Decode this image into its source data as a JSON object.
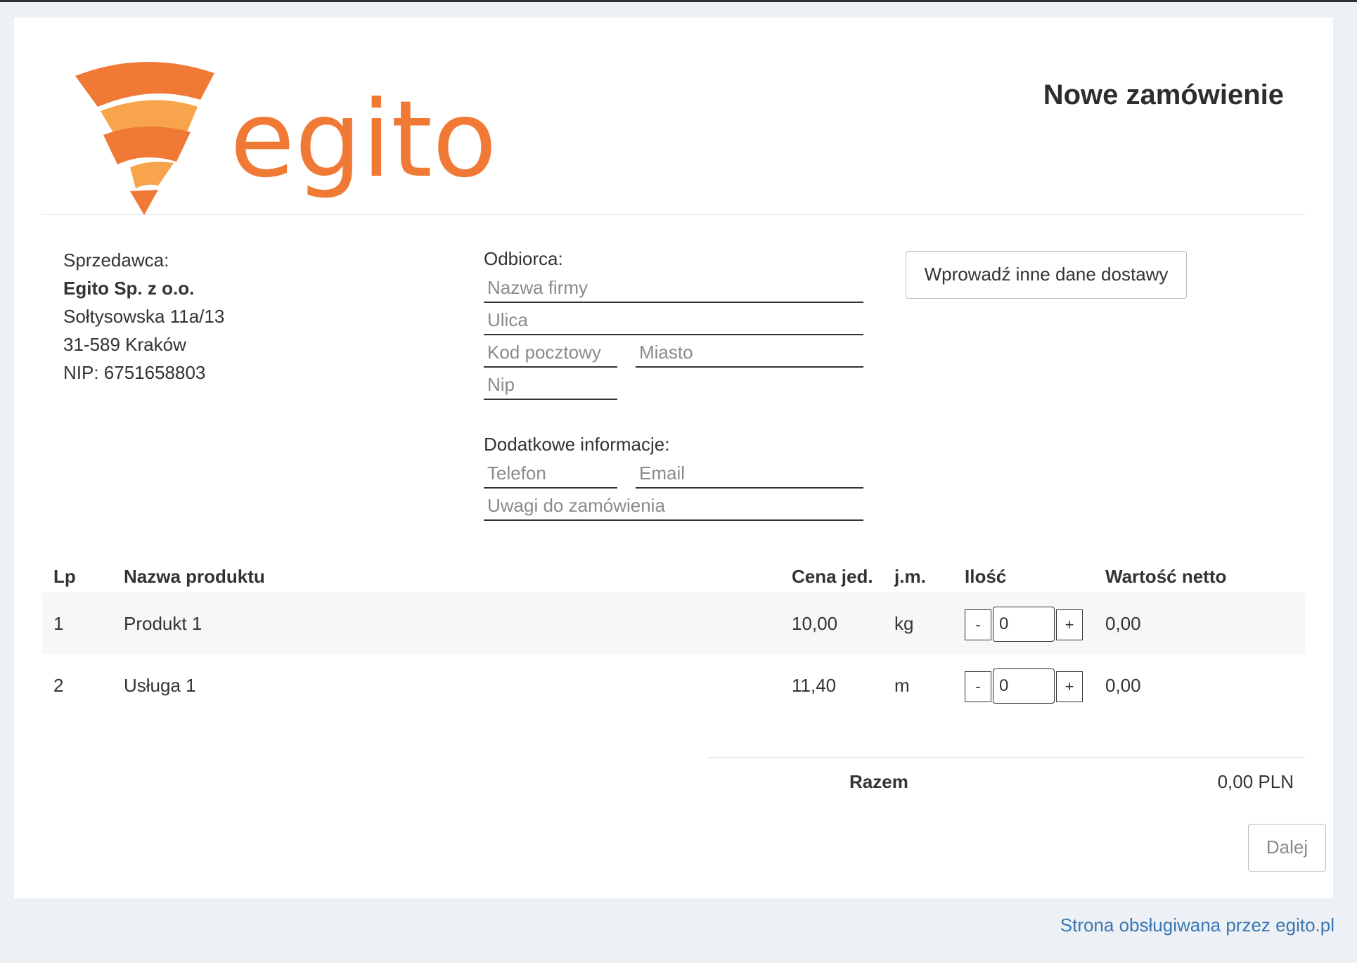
{
  "brand": {
    "name": "egito",
    "color": "#f07a35",
    "color_light": "#f7a44c"
  },
  "header": {
    "title": "Nowe zamówienie"
  },
  "seller": {
    "label": "Sprzedawca:",
    "name": "Egito Sp. z o.o.",
    "street": "Sołtysowska 11a/13",
    "city": "31-589 Kraków",
    "nip": "NIP: 6751658803"
  },
  "recipient": {
    "label": "Odbiorca:",
    "company_placeholder": "Nazwa firmy",
    "street_placeholder": "Ulica",
    "postcode_placeholder": "Kod pocztowy",
    "city_placeholder": "Miasto",
    "nip_placeholder": "Nip"
  },
  "additional": {
    "label": "Dodatkowe informacje:",
    "phone_placeholder": "Telefon",
    "email_placeholder": "Email",
    "notes_placeholder": "Uwagi do zamówienia"
  },
  "delivery_button": "Wprowadź inne dane dostawy",
  "table": {
    "columns": [
      "Lp",
      "Nazwa produktu",
      "Cena jed.",
      "j.m.",
      "Ilość",
      "Wartość netto"
    ],
    "rows": [
      {
        "lp": "1",
        "name": "Produkt 1",
        "price": "10,00",
        "unit": "kg",
        "qty": "0",
        "net": "0,00"
      },
      {
        "lp": "2",
        "name": "Usługa 1",
        "price": "11,40",
        "unit": "m",
        "qty": "0",
        "net": "0,00"
      }
    ],
    "minus": "-",
    "plus": "+"
  },
  "total": {
    "label": "Razem",
    "value": "0,00 PLN"
  },
  "next_button": "Dalej",
  "footer": {
    "text": "Strona obsługiwana przez egito.pl"
  }
}
